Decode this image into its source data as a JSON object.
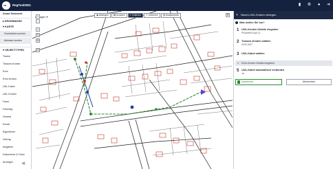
{
  "app": {
    "title": "RegTool2001",
    "logo_text": "SN"
  },
  "sidebar": {
    "header": "Smart Netzwerk",
    "groups": [
      {
        "label": "ERGEBNISSE",
        "icon": "list-icon"
      },
      {
        "label": "KARTE",
        "icon": "map-icon"
      }
    ],
    "map_items": [
      "Grundstück suchen",
      "Adresse suchen"
    ],
    "objects_header": "OBJEKTTYPEN",
    "object_items": [
      "Trasse",
      "Trassen-Knoten",
      "Rohr",
      "Rohr-Knoten",
      "LWL-Kabel",
      "LWL-Knoten",
      "Faser",
      "Fasertag",
      "Gewest",
      "Kunde",
      "Eigentümer",
      "Vertrag",
      "Aufgaben",
      "Dokumente & Fotos",
      "Anzeigen"
    ],
    "collapse_icon": "double-chevron-left-icon"
  },
  "map": {
    "fetch_label": "Abfragen ▾",
    "toolbar": [
      {
        "label": "Abzeigen",
        "icon": "eye-icon",
        "active": false
      },
      {
        "label": "Drucken",
        "icon": "print-icon",
        "active": false
      },
      {
        "label": "Collector",
        "icon": "layers-icon",
        "active": true
      },
      {
        "label": "Zeichnen",
        "icon": "pen-icon",
        "active": false
      },
      {
        "label": "Analysetools",
        "icon": "chart-icon",
        "active": false
      }
    ],
    "controls": [
      "+",
      "−",
      "⌂",
      "◎",
      "⊕",
      "⊡"
    ],
    "right_control": "⚙"
  },
  "panel": {
    "title": "Neuen LWL-Knoten verlegen",
    "question": "Was wollen Sie tun?",
    "steps": [
      {
        "num": "1",
        "title": "LWL-Knoten Details eingeben",
        "value": "Poschfeld Kopf 12"
      },
      {
        "num": "2",
        "title": "Trassen-Knoten wählen",
        "value": "SGH-2007"
      },
      {
        "num": "3",
        "title": "LWL-Kabel wählen",
        "value": ""
      },
      {
        "num": "4",
        "title": "Rohr-Knoten Details eingeben",
        "value": ""
      },
      {
        "num": "5",
        "title": "LWL-Kabel automatisch verbinden",
        "value": "Ja"
      }
    ],
    "save_label": "Speichern",
    "cancel_label": "Abbrechen"
  },
  "colors": {
    "topbar": "#14213f",
    "panel_header": "#1d2a44",
    "route": "#2e8a35",
    "cable": "#1f3fa0",
    "parcel": "#c0392b"
  }
}
